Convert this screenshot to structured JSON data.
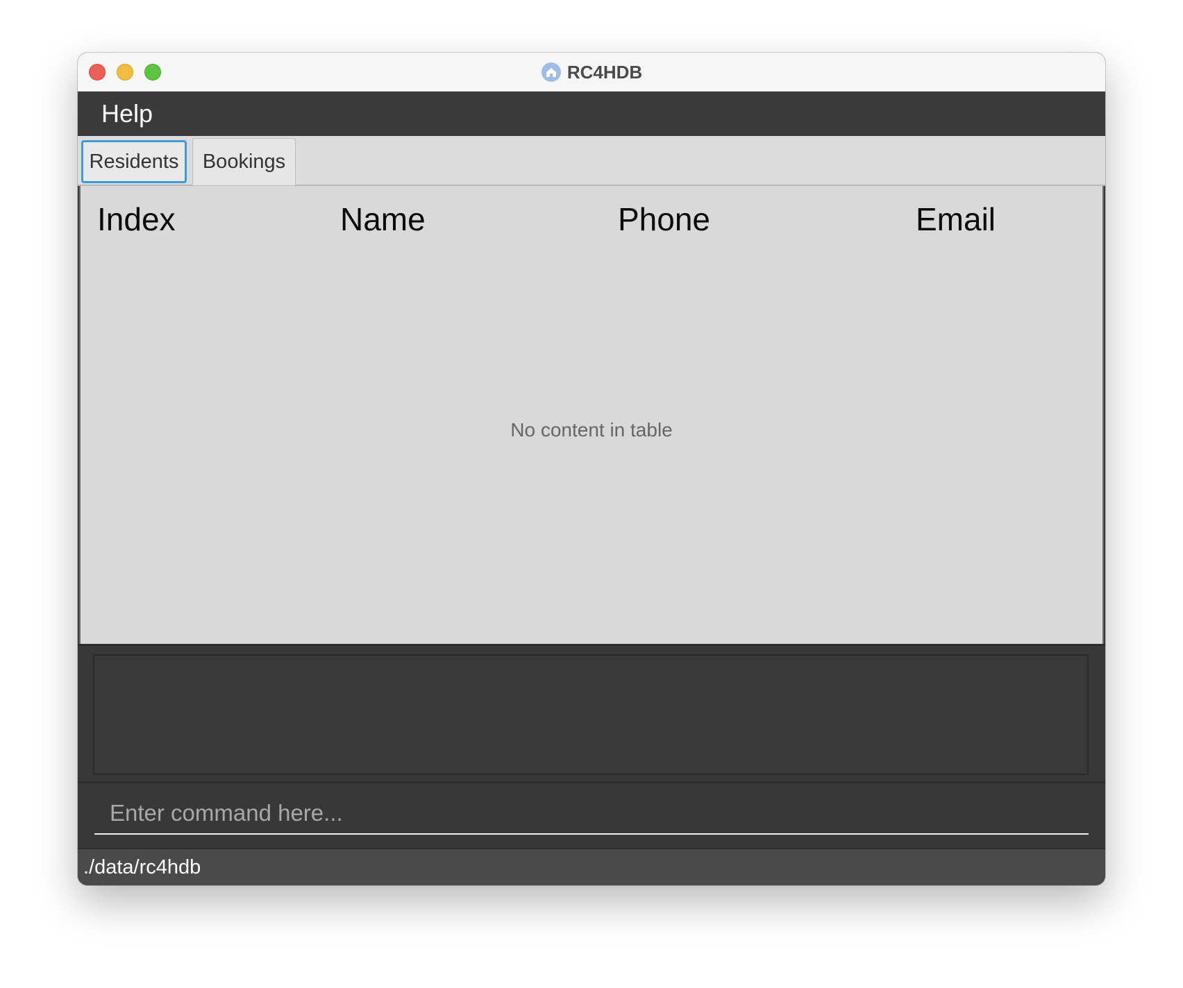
{
  "window": {
    "title": "RC4HDB",
    "app_icon": "house-icon"
  },
  "menubar": {
    "items": [
      {
        "label": "Help"
      }
    ]
  },
  "tabs": [
    {
      "label": "Residents",
      "selected": true
    },
    {
      "label": "Bookings",
      "selected": false
    }
  ],
  "table": {
    "columns": [
      "Index",
      "Name",
      "Phone",
      "Email"
    ],
    "rows": [],
    "empty_message": "No content in table"
  },
  "result_display": {
    "text": ""
  },
  "command_box": {
    "value": "",
    "placeholder": "Enter command here..."
  },
  "status_bar": {
    "path": "./data/rc4hdb"
  },
  "colors": {
    "menubar_bg": "#3a3a3a",
    "table_bg": "#d9d9d9",
    "panel_bg": "#383838",
    "status_bg": "#4a4a4a",
    "tab_focus": "#3a9bd6"
  }
}
